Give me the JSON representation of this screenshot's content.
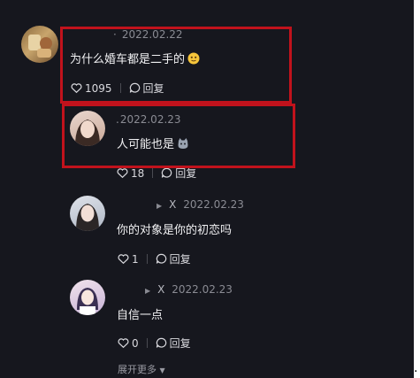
{
  "comments": [
    {
      "id": "main",
      "date": "2022.02.22",
      "text": "为什么婚车都是二手的",
      "likes": "1095",
      "reply_label": "回复"
    },
    {
      "id": "reply1",
      "date": "2022.02.23",
      "text": "人可能也是",
      "likes": "18",
      "reply_label": "回复"
    },
    {
      "id": "reply2",
      "marker": "X",
      "date": "2022.02.23",
      "text": "你的对象是你的初恋吗",
      "likes": "1",
      "reply_label": "回复"
    },
    {
      "id": "reply3",
      "marker": "X",
      "date": "2022.02.23",
      "text": "自信一点",
      "likes": "0",
      "reply_label": "回复"
    }
  ],
  "expand_more_label": "展开更多",
  "colors": {
    "background": "#16171e",
    "highlight_box": "#c1121c",
    "muted_text": "#8a8b93"
  },
  "icons": [
    "heart-icon",
    "speech-bubble-icon",
    "caret-right-icon",
    "chevron-down-icon"
  ]
}
